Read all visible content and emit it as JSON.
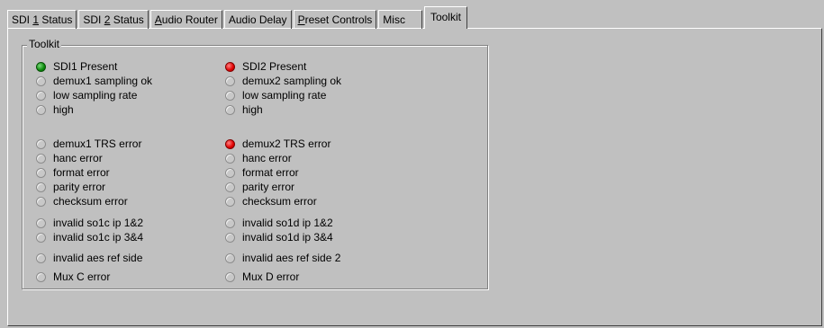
{
  "tabs": [
    {
      "pre": "SDI ",
      "key": "1",
      "post": " Status"
    },
    {
      "pre": "SDI ",
      "key": "2",
      "post": " Status"
    },
    {
      "pre": "",
      "key": "A",
      "post": "udio Router"
    },
    {
      "pre": "Audio Delay",
      "key": "",
      "post": ""
    },
    {
      "pre": "",
      "key": "P",
      "post": "reset Controls"
    },
    {
      "pre": "Misc",
      "key": "",
      "post": ""
    },
    {
      "pre": "Toolkit",
      "key": "",
      "post": ""
    }
  ],
  "group": {
    "title": "Toolkit",
    "left": [
      {
        "label": "SDI1 Present",
        "state": "green"
      },
      {
        "label": "demux1 sampling ok",
        "state": "off"
      },
      {
        "label": "low sampling rate",
        "state": "off"
      },
      {
        "label": "high",
        "state": "off"
      },
      {
        "label": "demux1 TRS error",
        "state": "off"
      },
      {
        "label": "hanc error",
        "state": "off"
      },
      {
        "label": "format error",
        "state": "off"
      },
      {
        "label": "parity error",
        "state": "off"
      },
      {
        "label": "checksum error",
        "state": "off"
      },
      {
        "label": "invalid so1c ip 1&2",
        "state": "off"
      },
      {
        "label": "invalid so1c ip 3&4",
        "state": "off"
      },
      {
        "label": "invalid aes ref side",
        "state": "off"
      },
      {
        "label": "Mux C error",
        "state": "off"
      }
    ],
    "right": [
      {
        "label": "SDI2 Present",
        "state": "red"
      },
      {
        "label": "demux2 sampling ok",
        "state": "off"
      },
      {
        "label": "low sampling rate",
        "state": "off"
      },
      {
        "label": "high",
        "state": "off"
      },
      {
        "label": "demux2 TRS error",
        "state": "red"
      },
      {
        "label": "hanc error",
        "state": "off"
      },
      {
        "label": "format error",
        "state": "off"
      },
      {
        "label": "parity error",
        "state": "off"
      },
      {
        "label": "checksum error",
        "state": "off"
      },
      {
        "label": "invalid so1d ip 1&2",
        "state": "off"
      },
      {
        "label": "invalid so1d ip 3&4",
        "state": "off"
      },
      {
        "label": "invalid aes ref side 2",
        "state": "off"
      },
      {
        "label": "Mux D error",
        "state": "off"
      }
    ]
  },
  "colors": {
    "background": "#c0c0c0",
    "led_green": "#0a8a0a",
    "led_red": "#e00000",
    "led_off": "#c8c8c8"
  }
}
